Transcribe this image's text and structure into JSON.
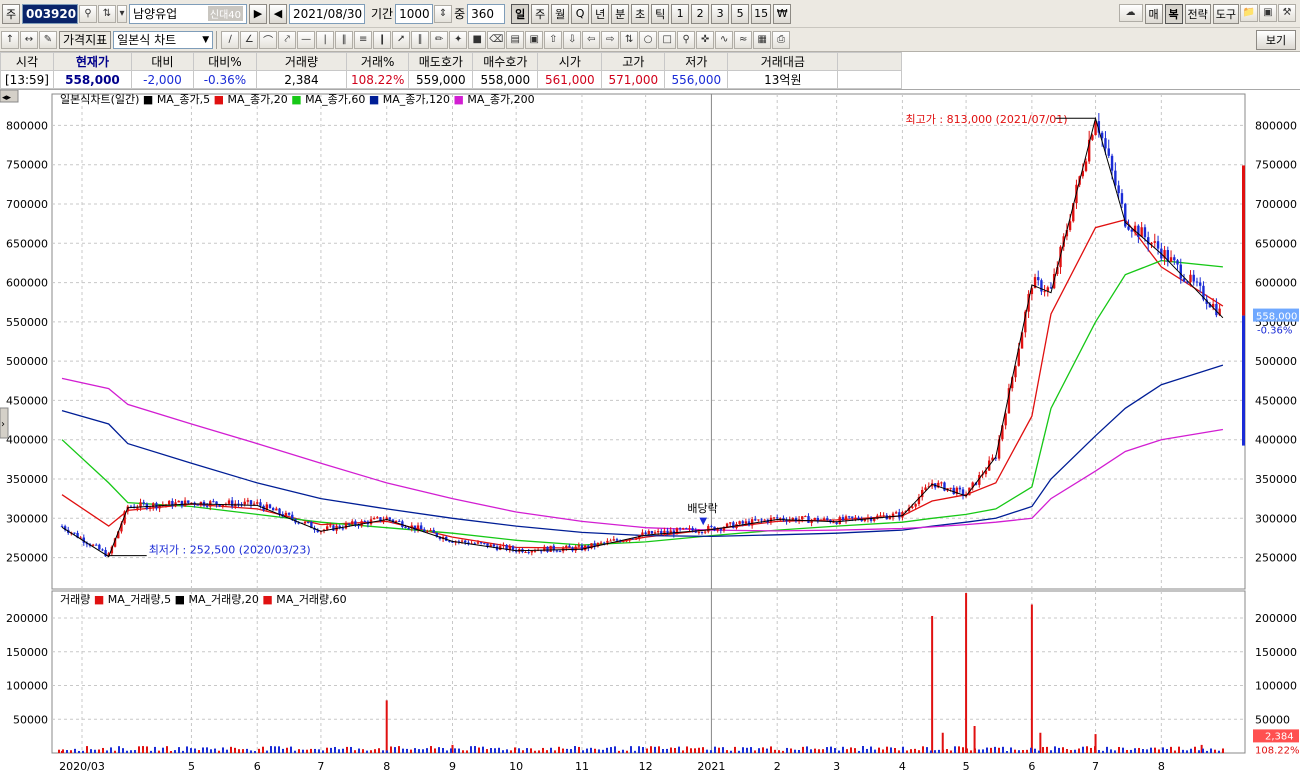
{
  "toolbar": {
    "market_label": "주",
    "code": "003920",
    "name": "남양유업",
    "tag": "신대40",
    "date": "2021/08/30",
    "period_label": "기간",
    "period": "1000",
    "count_label": "중",
    "count": "360",
    "period_buttons": [
      "일",
      "주",
      "월",
      "Q",
      "년",
      "분",
      "초",
      "틱",
      "1",
      "2",
      "3",
      "5",
      "15",
      "₩"
    ],
    "right_buttons": [
      "매",
      "복",
      "전략",
      "도구"
    ],
    "indicator_select": "가격지표",
    "chart_type_select": "일본식 차트",
    "view_button": "보기"
  },
  "quote": {
    "headers": [
      "시각",
      "현재가",
      "대비",
      "대비%",
      "거래량",
      "거래%",
      "매도호가",
      "매수호가",
      "시가",
      "고가",
      "저가",
      "거래대금"
    ],
    "values": [
      "[13:59]",
      "558,000",
      "-2,000",
      "-0.36%",
      "2,384",
      "108.22%",
      "559,000",
      "558,000",
      "561,000",
      "571,000",
      "556,000",
      "13억원"
    ]
  },
  "colors": {
    "up": "#e01010",
    "down": "#1a2bd6",
    "ma5": "#000000",
    "ma20": "#e01010",
    "ma60": "#16c816",
    "ma120": "#001e96",
    "ma200": "#d21ed2"
  },
  "price_panel": {
    "legend_title": "일본식차트(일간)",
    "legend_items": [
      "MA_종가,5",
      "MA_종가,20",
      "MA_종가,60",
      "MA_종가,120",
      "MA_종가,200"
    ],
    "high_annotation": "최고가 : 813,000 (2021/07/01)",
    "low_annotation": "최저가 : 252,500 (2020/03/23)",
    "dividend_label": "배당락",
    "current_price_tag": "558,000",
    "current_change_tag": "-0.36%"
  },
  "volume_panel": {
    "legend_title": "거래량",
    "legend_items": [
      "MA_거래량,5",
      "MA_거래량,20",
      "MA_거래량,60"
    ],
    "current_volume_tag": "2,384",
    "current_pct_tag": "108.22%"
  },
  "x_axis_labels": [
    "2020/03",
    "5",
    "6",
    "7",
    "8",
    "9",
    "10",
    "11",
    "12",
    "2021",
    "2",
    "3",
    "4",
    "5",
    "6",
    "7",
    "8"
  ],
  "chart_data": [
    {
      "type": "line",
      "title": "일본식차트(일간)",
      "ylim": [
        210000,
        840000
      ],
      "y_ticks": [
        250000,
        300000,
        350000,
        400000,
        450000,
        500000,
        550000,
        600000,
        650000,
        700000,
        750000,
        800000
      ],
      "x": [
        "2020/03",
        "2020/03/23",
        "2020/04",
        "2020/05",
        "2020/06",
        "2020/07",
        "2020/08",
        "2020/09",
        "2020/10",
        "2020/11",
        "2020/12",
        "2021/01",
        "2021/02",
        "2021/03",
        "2021/04",
        "2021/04/15",
        "2021/05",
        "2021/05/15",
        "2021/06",
        "2021/06/10",
        "2021/07/01",
        "2021/07/15",
        "2021/08",
        "2021/08/30"
      ],
      "series": [
        {
          "name": "종가",
          "values": [
            290000,
            252500,
            315000,
            320000,
            318000,
            285000,
            300000,
            272000,
            260000,
            262000,
            280000,
            287000,
            300000,
            297000,
            305000,
            345000,
            330000,
            380000,
            600000,
            590000,
            813000,
            680000,
            640000,
            558000
          ]
        },
        {
          "name": "MA_종가,20",
          "values": [
            330000,
            290000,
            310000,
            318000,
            312000,
            292000,
            296000,
            276000,
            263000,
            262000,
            276000,
            286000,
            296000,
            298000,
            303000,
            322000,
            330000,
            345000,
            430000,
            560000,
            670000,
            680000,
            620000,
            570000
          ]
        },
        {
          "name": "MA_종가,60",
          "values": [
            400000,
            345000,
            320000,
            315000,
            305000,
            295000,
            288000,
            281000,
            272000,
            266000,
            270000,
            278000,
            285000,
            290000,
            295000,
            300000,
            305000,
            312000,
            340000,
            440000,
            550000,
            610000,
            628000,
            620000
          ]
        },
        {
          "name": "MA_종가,120",
          "values": [
            437000,
            420000,
            395000,
            370000,
            345000,
            325000,
            312000,
            300000,
            290000,
            282000,
            278000,
            277000,
            279000,
            281000,
            285000,
            290000,
            295000,
            300000,
            315000,
            350000,
            405000,
            440000,
            470000,
            495000
          ]
        },
        {
          "name": "MA_종가,200",
          "values": [
            478000,
            465000,
            445000,
            420000,
            395000,
            370000,
            345000,
            325000,
            308000,
            296000,
            288000,
            285000,
            284000,
            285000,
            287000,
            289000,
            292000,
            295000,
            300000,
            325000,
            360000,
            385000,
            400000,
            413000
          ]
        }
      ]
    },
    {
      "type": "bar",
      "title": "거래량",
      "ylim": [
        0,
        240000
      ],
      "y_ticks": [
        50000,
        100000,
        150000,
        200000
      ],
      "x": [
        "2020/03",
        "2020/08",
        "2020/09",
        "2021/04/15",
        "2021/04/20",
        "2021/05/01",
        "2021/05/05",
        "2021/06/01",
        "2021/06/05",
        "2021/07/01",
        "2021/08/20",
        "2021/08/30"
      ],
      "values": [
        3000,
        78000,
        12000,
        203000,
        30000,
        237000,
        40000,
        220000,
        30000,
        28000,
        12000,
        2384
      ]
    }
  ]
}
